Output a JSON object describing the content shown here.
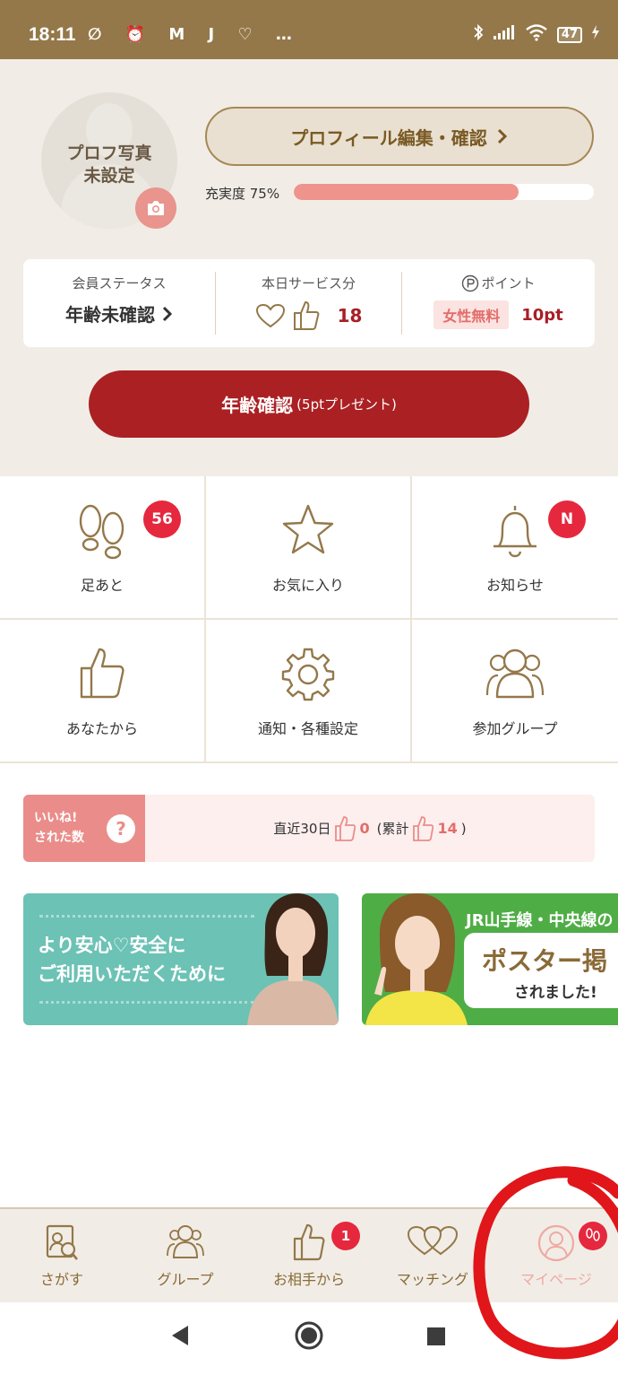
{
  "status_bar": {
    "time": "18:11",
    "left_icons": "∅ ⏰ M J ♡ …",
    "battery": "47",
    "colors": {
      "background": "#94784a"
    }
  },
  "profile": {
    "photo_text_line1": "プロフ写真",
    "photo_text_line2": "未設定",
    "edit_button": "プロフィール編集・確認",
    "completion_label": "充実度 75%",
    "completion_percent": 75
  },
  "stats": {
    "member_status_label": "会員ステータス",
    "member_status_value": "年齢未確認",
    "today_service_label": "本日サービス分",
    "today_service_value": "18",
    "points_label": "ポイント",
    "points_badge": "女性無料",
    "points_value": "10pt"
  },
  "age_button": {
    "main": "年齢確認",
    "sub": "(5ptプレゼント)"
  },
  "menu": {
    "footprints": {
      "label": "足あと",
      "badge": "56",
      "icon": "footprints-icon"
    },
    "favorites": {
      "label": "お気に入り",
      "icon": "star-icon"
    },
    "notices": {
      "label": "お知らせ",
      "badge": "N",
      "icon": "bell-icon"
    },
    "from_you": {
      "label": "あなたから",
      "icon": "thumbs-up-icon"
    },
    "settings": {
      "label": "通知・各種設定",
      "icon": "gear-icon"
    },
    "groups": {
      "label": "参加グループ",
      "icon": "people-icon"
    }
  },
  "likes": {
    "tag_line1": "いいね!",
    "tag_line2": "された数",
    "help": "?",
    "recent_label": "直近30日",
    "recent_value": "0",
    "total_open": "(累計",
    "total_value": "14",
    "total_close": ")"
  },
  "banners": {
    "banner1_line1": "より安心♡安全に",
    "banner1_line2": "ご利用いただくために",
    "banner2_heading": "JR山手線・中央線の",
    "banner2_big": "ポスター掲",
    "banner2_small": "されました!"
  },
  "bottom_nav": {
    "search": "さがす",
    "group": "グループ",
    "from_partner": "お相手から",
    "from_partner_badge": "1",
    "matching": "マッチング",
    "mypage": "マイページ"
  },
  "colors": {
    "accent_red": "#ab2023",
    "badge_red": "#e5283e",
    "gold": "#8a6a37",
    "pink": "#ea8d8a"
  }
}
